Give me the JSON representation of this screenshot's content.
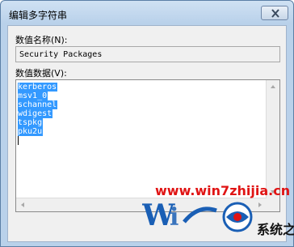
{
  "window": {
    "title": "编辑多字符串"
  },
  "form": {
    "name_label": "数值名称(N):",
    "name_value": "Security Packages",
    "data_label": "数值数据(V):",
    "data_lines": [
      "kerberos",
      "msv1_0",
      "schannel",
      "wdigest",
      "tspkg",
      "pku2u"
    ]
  },
  "watermark": {
    "url": "www.win7zhijia.cn",
    "brand": "系统之家"
  },
  "colors": {
    "selection": "#3399ff",
    "watermark_url": "#e01414",
    "watermark_logo": "#1a5fb5"
  }
}
